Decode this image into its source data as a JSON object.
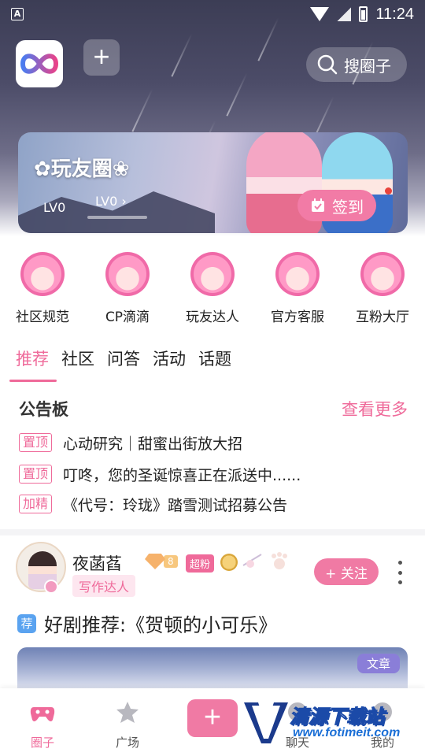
{
  "status_bar": {
    "time": "11:24",
    "left_icon_label": "A"
  },
  "header": {
    "search_label": "搜圈子",
    "add_label": "+"
  },
  "banner": {
    "title": "✿玩友圈❀",
    "level_current": "LV0",
    "level_next": "LV0",
    "level_next_chevron": "›",
    "checkin_label": "签到",
    "colors": {
      "checkin": "#f27ba6"
    }
  },
  "entries": [
    {
      "label": "社区规范",
      "icon": "anime-avatar-icon"
    },
    {
      "label": "CP滴滴",
      "icon": "anime-avatar-icon"
    },
    {
      "label": "玩友达人",
      "icon": "anime-avatar-icon"
    },
    {
      "label": "官方客服",
      "icon": "anime-avatar-icon"
    },
    {
      "label": "互粉大厅",
      "icon": "anime-avatar-icon"
    }
  ],
  "tabs": [
    {
      "label": "推荐",
      "active": true
    },
    {
      "label": "社区",
      "active": false
    },
    {
      "label": "问答",
      "active": false
    },
    {
      "label": "活动",
      "active": false
    },
    {
      "label": "话题",
      "active": false
    }
  ],
  "board": {
    "title": "公告板",
    "more_label": "查看更多",
    "notices": [
      {
        "tag": "置顶",
        "text": "心动研究｜甜蜜出街放大招"
      },
      {
        "tag": "置顶",
        "text": "叮咚，您的圣诞惊喜正在派送中......"
      },
      {
        "tag": "加精",
        "text": "《代号：玲珑》踏雪测试招募公告"
      }
    ]
  },
  "post": {
    "username": "夜菡萏",
    "user_title": "写作达人",
    "level": "8",
    "fan_badge": "超粉",
    "follow_label": "+ 关注",
    "rec_tag": "荐",
    "title": "好剧推荐:《贺顿的小可乐》",
    "type_tag": "文章"
  },
  "bottom_nav": {
    "items": [
      {
        "label": "圈子",
        "icon": "gamepad-icon",
        "active": true
      },
      {
        "label": "广场",
        "icon": "star-icon",
        "active": false
      },
      {
        "label": "聊天",
        "icon": "chat-icon",
        "active": false
      },
      {
        "label": "我的",
        "icon": "profile-icon",
        "active": false
      }
    ],
    "publish_label": "+"
  },
  "watermark": {
    "text": "清源下载站",
    "url": "www.fotimeit.com"
  },
  "colors": {
    "accent": "#ef6a9a",
    "sky": "#3c3d55"
  }
}
